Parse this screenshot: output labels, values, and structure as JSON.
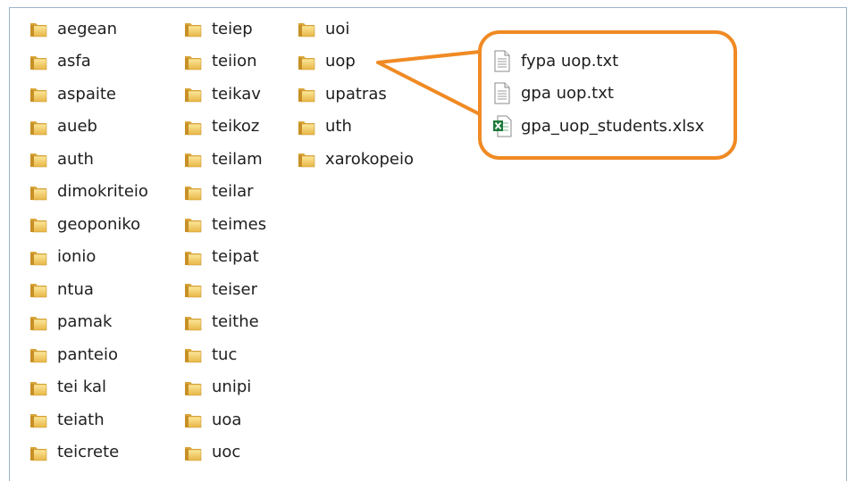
{
  "column1": [
    {
      "name": "aegean"
    },
    {
      "name": "asfa"
    },
    {
      "name": "aspaite"
    },
    {
      "name": "aueb"
    },
    {
      "name": "auth"
    },
    {
      "name": "dimokriteio"
    },
    {
      "name": "geoponiko"
    },
    {
      "name": "ionio"
    },
    {
      "name": "ntua"
    },
    {
      "name": "pamak"
    },
    {
      "name": "panteio"
    },
    {
      "name": "tei kal"
    },
    {
      "name": "teiath"
    },
    {
      "name": "teicrete"
    }
  ],
  "column2": [
    {
      "name": "teiep"
    },
    {
      "name": "teiion"
    },
    {
      "name": "teikav"
    },
    {
      "name": "teikoz"
    },
    {
      "name": "teilam"
    },
    {
      "name": "teilar"
    },
    {
      "name": "teimes"
    },
    {
      "name": "teipat"
    },
    {
      "name": "teiser"
    },
    {
      "name": "teithe"
    },
    {
      "name": "tuc"
    },
    {
      "name": "unipi"
    },
    {
      "name": "uoa"
    },
    {
      "name": "uoc"
    }
  ],
  "column3": [
    {
      "name": "uoi"
    },
    {
      "name": "uop"
    },
    {
      "name": "upatras"
    },
    {
      "name": "uth"
    },
    {
      "name": "xarokopeio"
    }
  ],
  "uop_contents": [
    {
      "name": "fypa uop.txt",
      "icon": "text-file-icon"
    },
    {
      "name": "gpa uop.txt",
      "icon": "text-file-icon"
    },
    {
      "name": "gpa_uop_students.xlsx",
      "icon": "excel-file-icon"
    }
  ],
  "colors": {
    "highlight": "#f08a24",
    "folder": "#e8b94a",
    "excel": "#1f7a3a"
  }
}
